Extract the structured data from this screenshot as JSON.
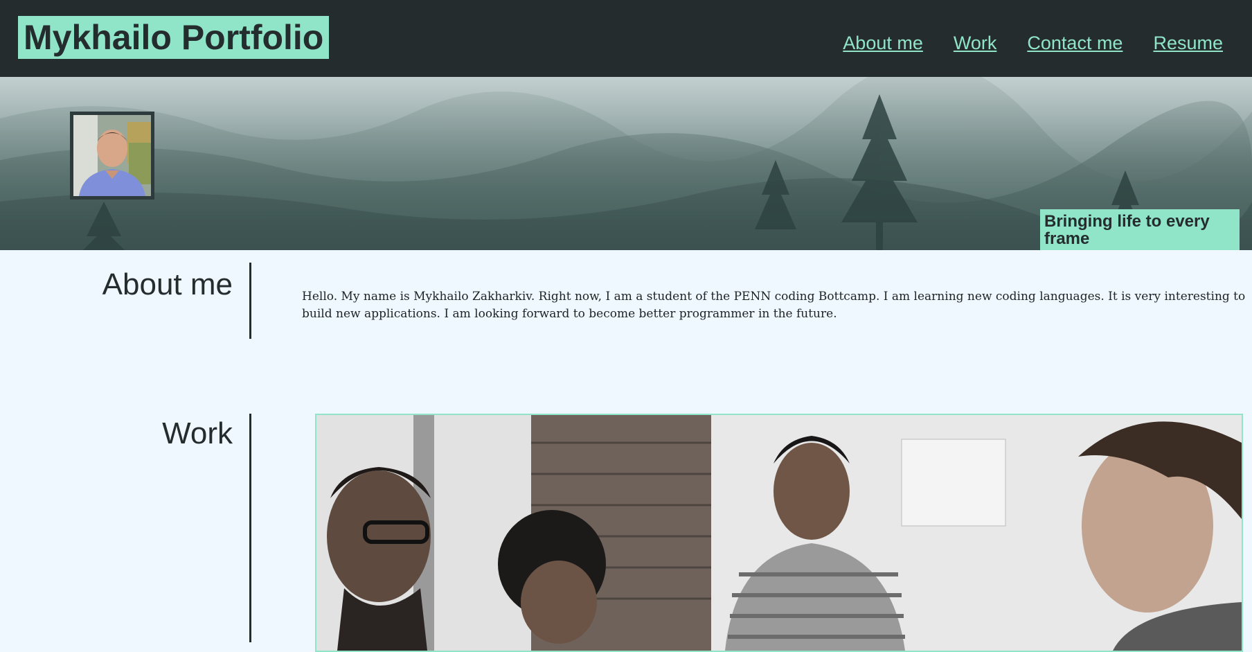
{
  "header": {
    "title": "Mykhailo Portfolio",
    "nav": [
      "About me",
      "Work",
      "Contact me",
      "Resume"
    ]
  },
  "hero": {
    "tagline": "Bringing life to every frame"
  },
  "about": {
    "heading": "About me",
    "text": "Hello. My name is Mykhailo Zakharkiv. Right now, I am a student of the PENN coding Bottcamp. I am learning new coding languages. It is very interesting to build new applications. I am looking forward to become better programmer in the future."
  },
  "work": {
    "heading": "Work"
  },
  "colors": {
    "header_bg": "#242c2e",
    "accent": "#90e4c8",
    "page_bg": "#f0f8ff"
  }
}
